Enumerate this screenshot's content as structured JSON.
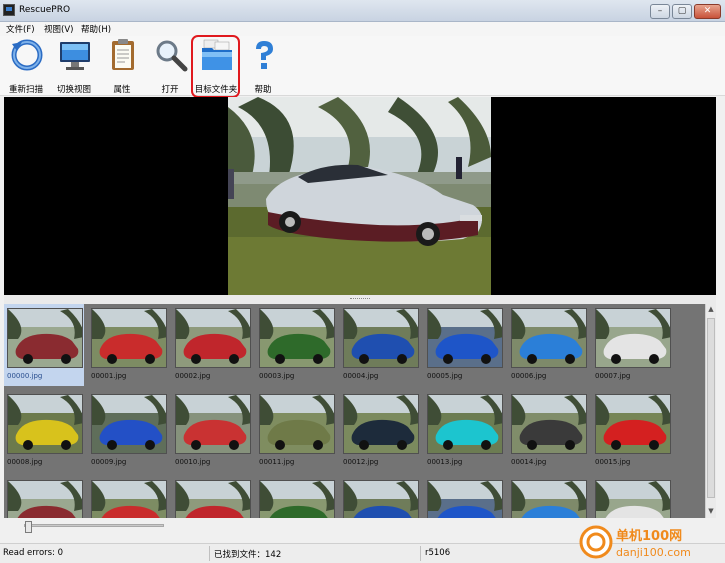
{
  "window": {
    "title": "RescuePRO"
  },
  "menu": [
    {
      "label": "文件(F)"
    },
    {
      "label": "视图(V)"
    },
    {
      "label": "帮助(H)"
    }
  ],
  "toolbar": {
    "rescan": "重新扫描",
    "switch_view": "切换视图",
    "properties": "属性",
    "open": "打开",
    "target_folder": "目标文件夹",
    "help": "帮助"
  },
  "gallery": {
    "thumbnails": [
      "00000.jpg",
      "00001.jpg",
      "00002.jpg",
      "00003.jpg",
      "00004.jpg",
      "00005.jpg",
      "00006.jpg",
      "00007.jpg",
      "00008.jpg",
      "00009.jpg",
      "00010.jpg",
      "00011.jpg",
      "00012.jpg",
      "00013.jpg",
      "00014.jpg",
      "00015.jpg"
    ],
    "selected": "00000.jpg"
  },
  "status": {
    "read_errors": "Read errors: 0",
    "found_files": "已找到文件：142",
    "version": "r5106"
  },
  "watermark": {
    "brand": "单机100网",
    "site": "danji100.com"
  },
  "colors": {
    "highlight": "#e0191e",
    "selection": "#c3d5ee"
  }
}
